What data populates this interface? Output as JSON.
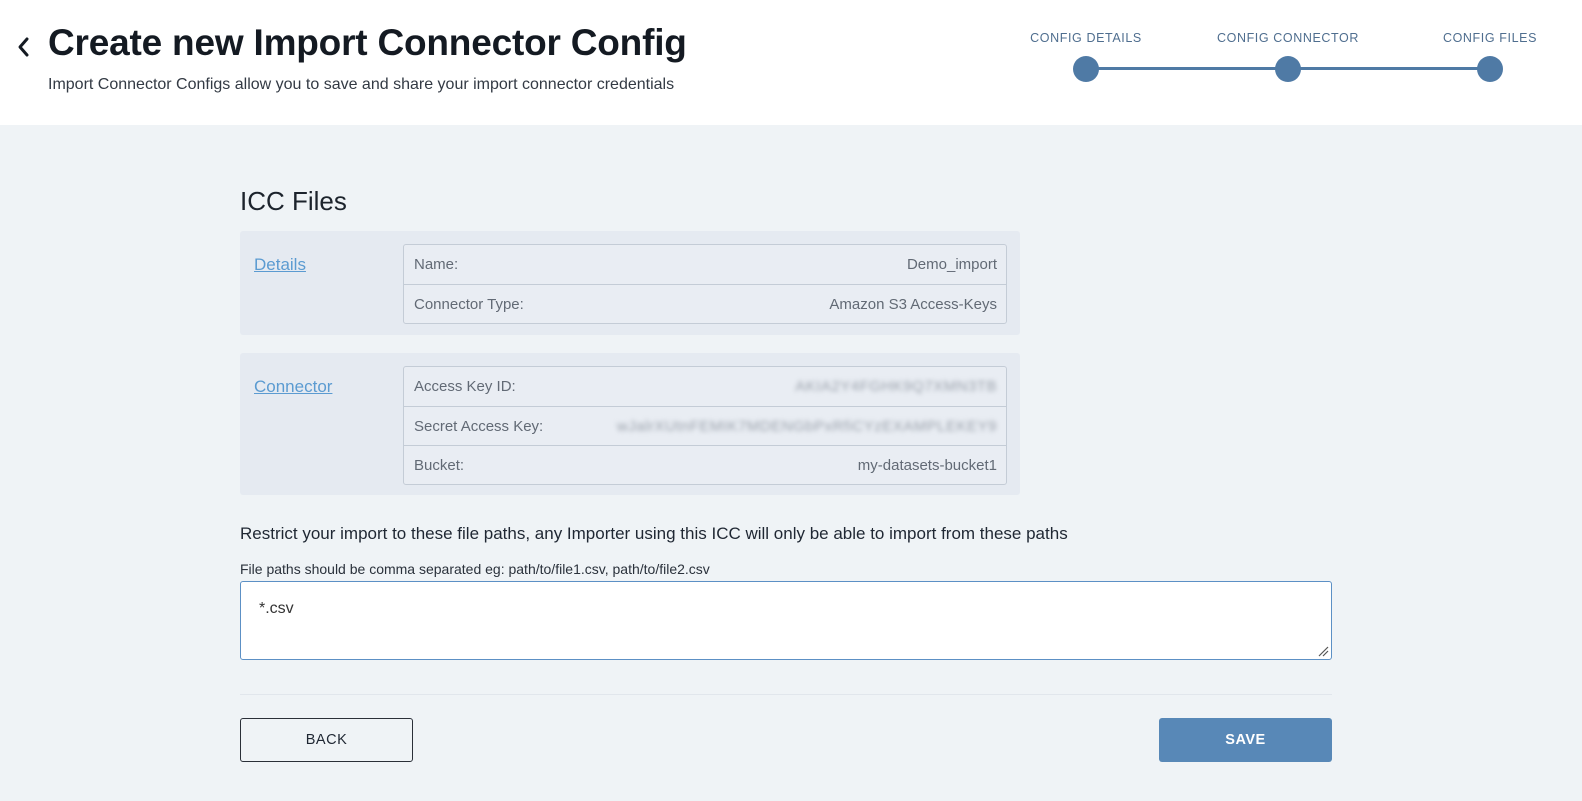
{
  "header": {
    "title": "Create new Import Connector Config",
    "subtitle": "Import Connector Configs allow you to save and share your import connector credentials",
    "back_icon": "chevron-left-icon"
  },
  "stepper": {
    "steps": [
      {
        "label": "CONFIG DETAILS",
        "state": "complete"
      },
      {
        "label": "CONFIG CONNECTOR",
        "state": "complete"
      },
      {
        "label": "CONFIG FILES",
        "state": "current"
      }
    ],
    "color": "#4f7aa5"
  },
  "main": {
    "section_title": "ICC Files",
    "details": {
      "link_label": "Details",
      "rows": [
        {
          "key": "Name:",
          "value": "Demo_import"
        },
        {
          "key": "Connector Type:",
          "value": "Amazon S3 Access-Keys"
        }
      ]
    },
    "connector": {
      "link_label": "Connector",
      "rows": [
        {
          "key": "Access Key ID:",
          "value": "AKIA2Y4FGHK9Q7XMN3TB",
          "masked": true
        },
        {
          "key": "Secret Access Key:",
          "value": "wJalrXUtnFEMIK7MDENGbPxRfiCYzEXAMPLEKEY9",
          "masked": true
        },
        {
          "key": "Bucket:",
          "value": "my-datasets-bucket1"
        }
      ]
    },
    "restrict_text": "Restrict your import to these file paths, any Importer using this ICC will only be able to import from these paths",
    "paths_hint": "File paths should be comma separated eg: path/to/file1.csv, path/to/file2.csv",
    "paths_value": "*.csv",
    "back_label": "BACK",
    "save_label": "SAVE",
    "accent_color": "#5888b7",
    "link_color": "#5b9bd1"
  }
}
